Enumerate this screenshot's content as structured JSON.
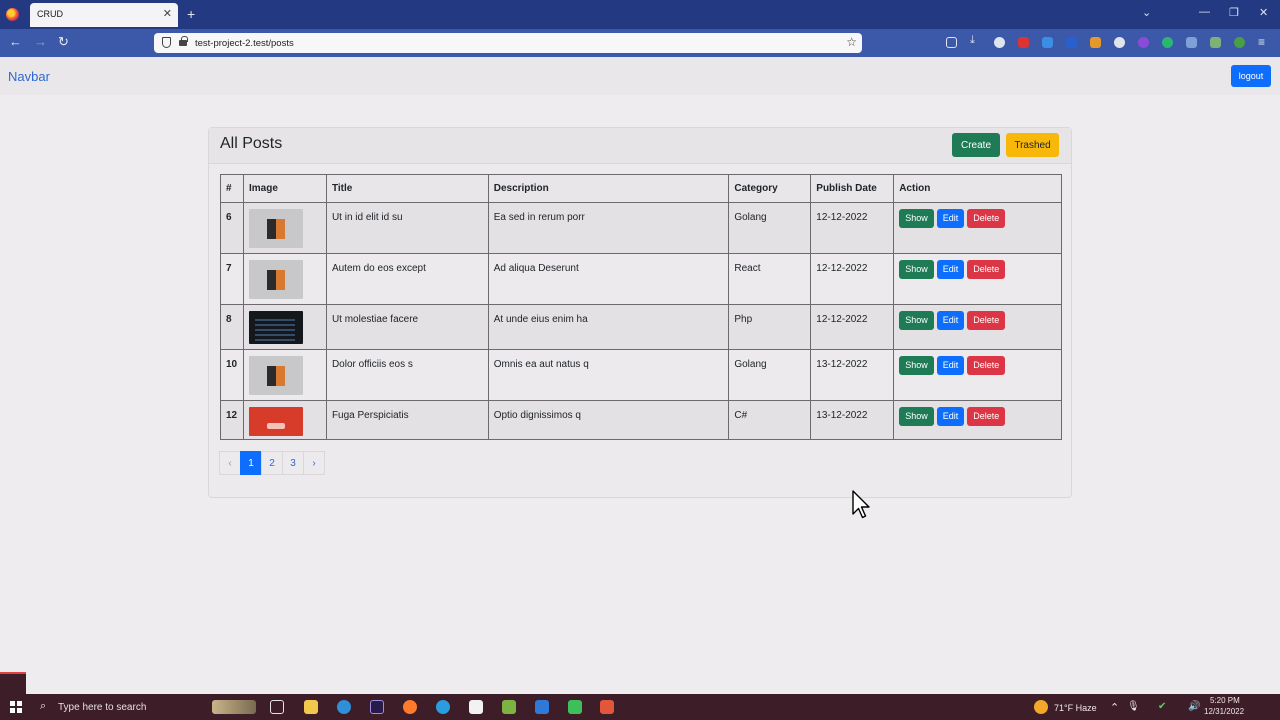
{
  "browser": {
    "tab_title": "CRUD",
    "tab_close": "✕",
    "new_tab": "+",
    "url": "test-project-2.test/posts",
    "window_controls": [
      "⌄",
      "—",
      "❐",
      "✕"
    ]
  },
  "navbar": {
    "brand": "Navbar",
    "logout_label": "logout"
  },
  "card": {
    "title": "All Posts",
    "create_label": "Create",
    "trashed_label": "Trashed"
  },
  "table": {
    "headers": [
      "#",
      "Image",
      "Title",
      "Description",
      "Category",
      "Publish Date",
      "Action"
    ],
    "rows": [
      {
        "id": "6",
        "image": "gray",
        "title": "Ut in id elit id su",
        "description": "Ea sed in rerum porr",
        "category": "Golang",
        "date": "12-12-2022"
      },
      {
        "id": "7",
        "image": "gray",
        "title": "Autem do eos except",
        "description": "Ad aliqua Deserunt",
        "category": "React",
        "date": "12-12-2022"
      },
      {
        "id": "8",
        "image": "dark",
        "title": "Ut molestiae facere",
        "description": "At unde eius enim ha",
        "category": "Php",
        "date": "12-12-2022"
      },
      {
        "id": "10",
        "image": "gray",
        "title": "Dolor officiis eos s",
        "description": "Omnis ea aut natus q",
        "category": "Golang",
        "date": "13-12-2022"
      },
      {
        "id": "12",
        "image": "red",
        "title": "Fuga Perspiciatis",
        "description": "Optio dignissimos q",
        "category": "C#",
        "date": "13-12-2022"
      }
    ],
    "actions": {
      "show": "Show",
      "edit": "Edit",
      "delete": "Delete"
    }
  },
  "pagination": {
    "prev": "‹",
    "pages": [
      "1",
      "2",
      "3"
    ],
    "next": "›",
    "active": "1"
  },
  "taskbar": {
    "search_placeholder": "Type here to search",
    "weather": "71°F  Haze",
    "time": "5:20 PM",
    "date": "12/31/2022"
  },
  "colors": {
    "primary": "#0d6efd",
    "success": "#1e7b56",
    "warning": "#f7b80a",
    "danger": "#dc3545",
    "browser_title": "#233a82",
    "browser_nav": "#3c58a8",
    "taskbar": "#3c1d28"
  }
}
